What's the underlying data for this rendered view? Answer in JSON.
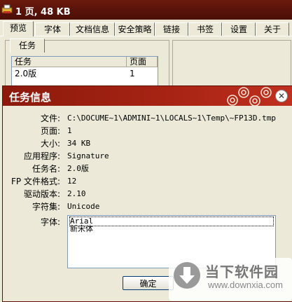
{
  "window": {
    "title": "1 页, 48 KB"
  },
  "tabs": [
    {
      "label": "预览"
    },
    {
      "label": "字体"
    },
    {
      "label": "文档信息"
    },
    {
      "label": "安全策略"
    },
    {
      "label": "链接"
    },
    {
      "label": "书签"
    },
    {
      "label": "设置"
    },
    {
      "label": "关于"
    }
  ],
  "left_panel": {
    "subtab": "任务",
    "columns": [
      "任务",
      "页面"
    ],
    "rows": [
      {
        "task": "2.0版",
        "page": "1"
      }
    ]
  },
  "dialog": {
    "title": "任务信息",
    "close_icon": "close-icon",
    "fields": [
      {
        "label": "文件:",
        "value": "C:\\DOCUME~1\\ADMINI~1\\LOCALS~1\\Temp\\~FP13D.tmp"
      },
      {
        "label": "页面:",
        "value": "1"
      },
      {
        "label": "大小:",
        "value": "34 KB"
      },
      {
        "label": "应用程序:",
        "value": "Signature"
      },
      {
        "label": "任务名:",
        "value": "2.0版"
      },
      {
        "label": "FP 文件格式:",
        "value": "12"
      },
      {
        "label": "驱动版本:",
        "value": "2.10"
      },
      {
        "label": "字符集:",
        "value": "Unicode"
      }
    ],
    "fonts_label": "字体:",
    "fonts": [
      "Arial",
      "新宋体"
    ],
    "ok_label": "确定"
  },
  "watermark": {
    "name": "当下软件园",
    "url": "www.downxia.com"
  },
  "colors": {
    "titlebar": "#5a1208",
    "dialog_title": "#a82414",
    "face": "#ece9d8"
  }
}
